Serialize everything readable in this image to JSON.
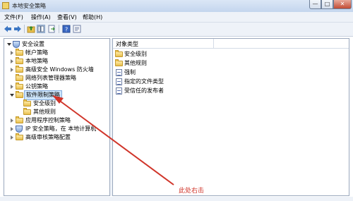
{
  "window": {
    "title": "本地安全策略"
  },
  "menu": [
    {
      "label": "文件(F)"
    },
    {
      "label": "操作(A)"
    },
    {
      "label": "查看(V)"
    },
    {
      "label": "帮助(H)"
    }
  ],
  "toolbar": {
    "icons": [
      "back-icon",
      "forward-icon",
      "up-folder-icon",
      "show-hide-tree-icon",
      "export-list-icon",
      "help-icon",
      "properties-icon"
    ]
  },
  "tree": {
    "items": [
      {
        "label": "安全设置",
        "icon": "shield-icon",
        "expanded": true,
        "selected": false
      },
      {
        "label": "帐户策略",
        "icon": "folder-icon",
        "expanded": false,
        "selected": false
      },
      {
        "label": "本地策略",
        "icon": "folder-icon",
        "expanded": false,
        "selected": false
      },
      {
        "label": "高级安全 Windows 防火墙",
        "icon": "folder-icon",
        "expanded": false,
        "selected": false
      },
      {
        "label": "网络列表管理器策略",
        "icon": "folder-icon",
        "expanded": false,
        "selected": false
      },
      {
        "label": "公钥策略",
        "icon": "folder-icon",
        "expanded": false,
        "selected": false
      },
      {
        "label": "软件限制策略",
        "icon": "folder-icon",
        "expanded": true,
        "selected": true
      },
      {
        "label": "安全级别",
        "icon": "folder-icon",
        "expanded": false,
        "selected": false
      },
      {
        "label": "其他规则",
        "icon": "folder-icon",
        "expanded": false,
        "selected": false
      },
      {
        "label": "应用程序控制策略",
        "icon": "folder-icon",
        "expanded": false,
        "selected": false
      },
      {
        "label": "IP 安全策略，在 本地计算机",
        "icon": "network-policy-icon",
        "expanded": false,
        "selected": false
      },
      {
        "label": "高级审核策略配置",
        "icon": "folder-icon",
        "expanded": false,
        "selected": false
      }
    ]
  },
  "list": {
    "column_header": "对象类型",
    "items": [
      {
        "label": "安全级别",
        "icon": "folder-icon"
      },
      {
        "label": "其他规则",
        "icon": "folder-icon"
      },
      {
        "label": "强制",
        "icon": "policy-doc-icon"
      },
      {
        "label": "指定的文件类型",
        "icon": "policy-doc-icon"
      },
      {
        "label": "受信任的发布者",
        "icon": "policy-doc-icon"
      }
    ]
  },
  "annotation": {
    "text": "此处右击",
    "color": "#d0352a"
  },
  "colors": {
    "selection": "#cde5fb",
    "accent_arrow": "#d0352a"
  }
}
